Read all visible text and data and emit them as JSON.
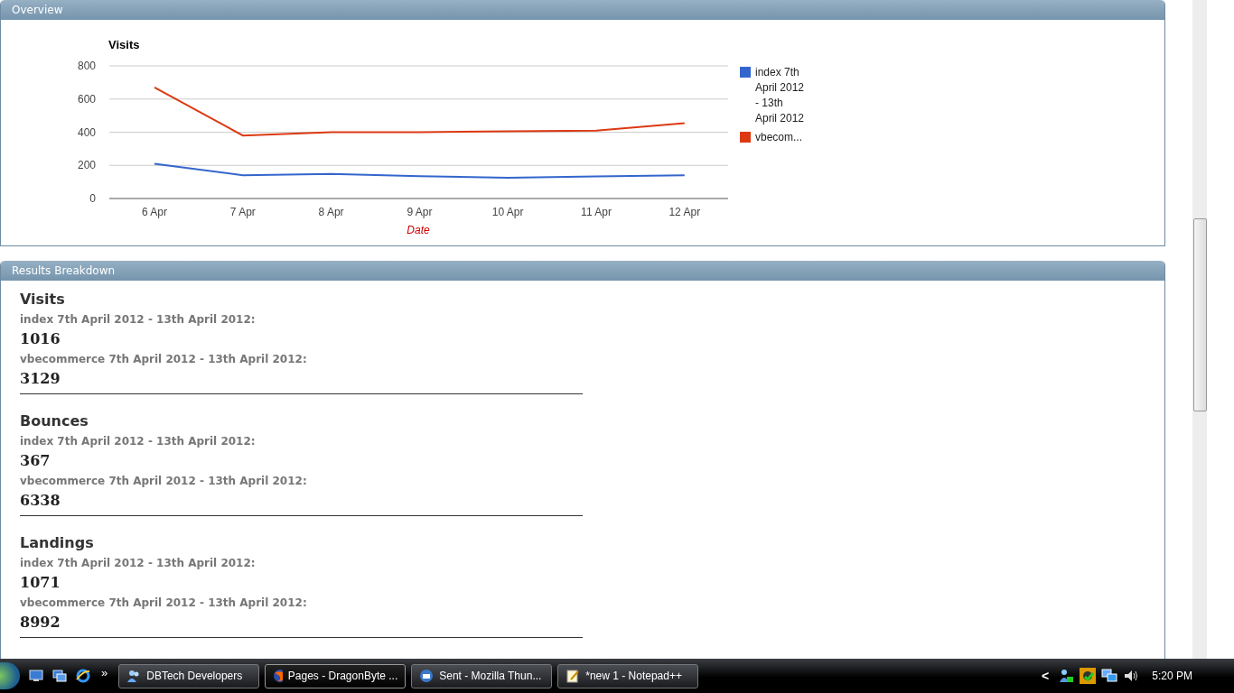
{
  "overview": {
    "title": "Overview",
    "chart_data": {
      "type": "line",
      "title": "Visits",
      "xlabel": "Date",
      "categories": [
        "6 Apr",
        "7 Apr",
        "8 Apr",
        "9 Apr",
        "10 Apr",
        "11 Apr",
        "12 Apr"
      ],
      "ylim": [
        0,
        800
      ],
      "grid": true,
      "legend": true,
      "yticks": [
        0,
        200,
        400,
        600,
        800
      ],
      "series": [
        {
          "name": "index 7th April 2012 - 13th April 2012",
          "color": "#3366cc",
          "values": [
            210,
            140,
            148,
            135,
            125,
            133,
            140
          ]
        },
        {
          "name": "vbecom...",
          "color": "#dc3912",
          "values": [
            670,
            380,
            400,
            400,
            405,
            410,
            455
          ]
        }
      ]
    }
  },
  "breakdown": {
    "title": "Results Breakdown",
    "sections": [
      {
        "title": "Visits",
        "entries": [
          {
            "label": "index 7th April 2012 - 13th April 2012:",
            "value": "1016"
          },
          {
            "label": "vbecommerce 7th April 2012 - 13th April 2012:",
            "value": "3129"
          }
        ]
      },
      {
        "title": "Bounces",
        "entries": [
          {
            "label": "index 7th April 2012 - 13th April 2012:",
            "value": "367"
          },
          {
            "label": "vbecommerce 7th April 2012 - 13th April 2012:",
            "value": "6338"
          }
        ]
      },
      {
        "title": "Landings",
        "entries": [
          {
            "label": "index 7th April 2012 - 13th April 2012:",
            "value": "1071"
          },
          {
            "label": "vbecommerce 7th April 2012 - 13th April 2012:",
            "value": "8992"
          }
        ]
      }
    ]
  },
  "taskbar": {
    "more": "»",
    "tasks": [
      {
        "label": "DBTech Developers",
        "kind": "people",
        "selected": false
      },
      {
        "label": "Pages - DragonByte ...",
        "kind": "browser",
        "selected": true
      },
      {
        "label": "Sent - Mozilla Thun...",
        "kind": "mail",
        "selected": false
      },
      {
        "label": "*new  1 - Notepad++",
        "kind": "notepad",
        "selected": false
      }
    ],
    "tray_arrow": "<",
    "clock": "5:20 PM"
  }
}
